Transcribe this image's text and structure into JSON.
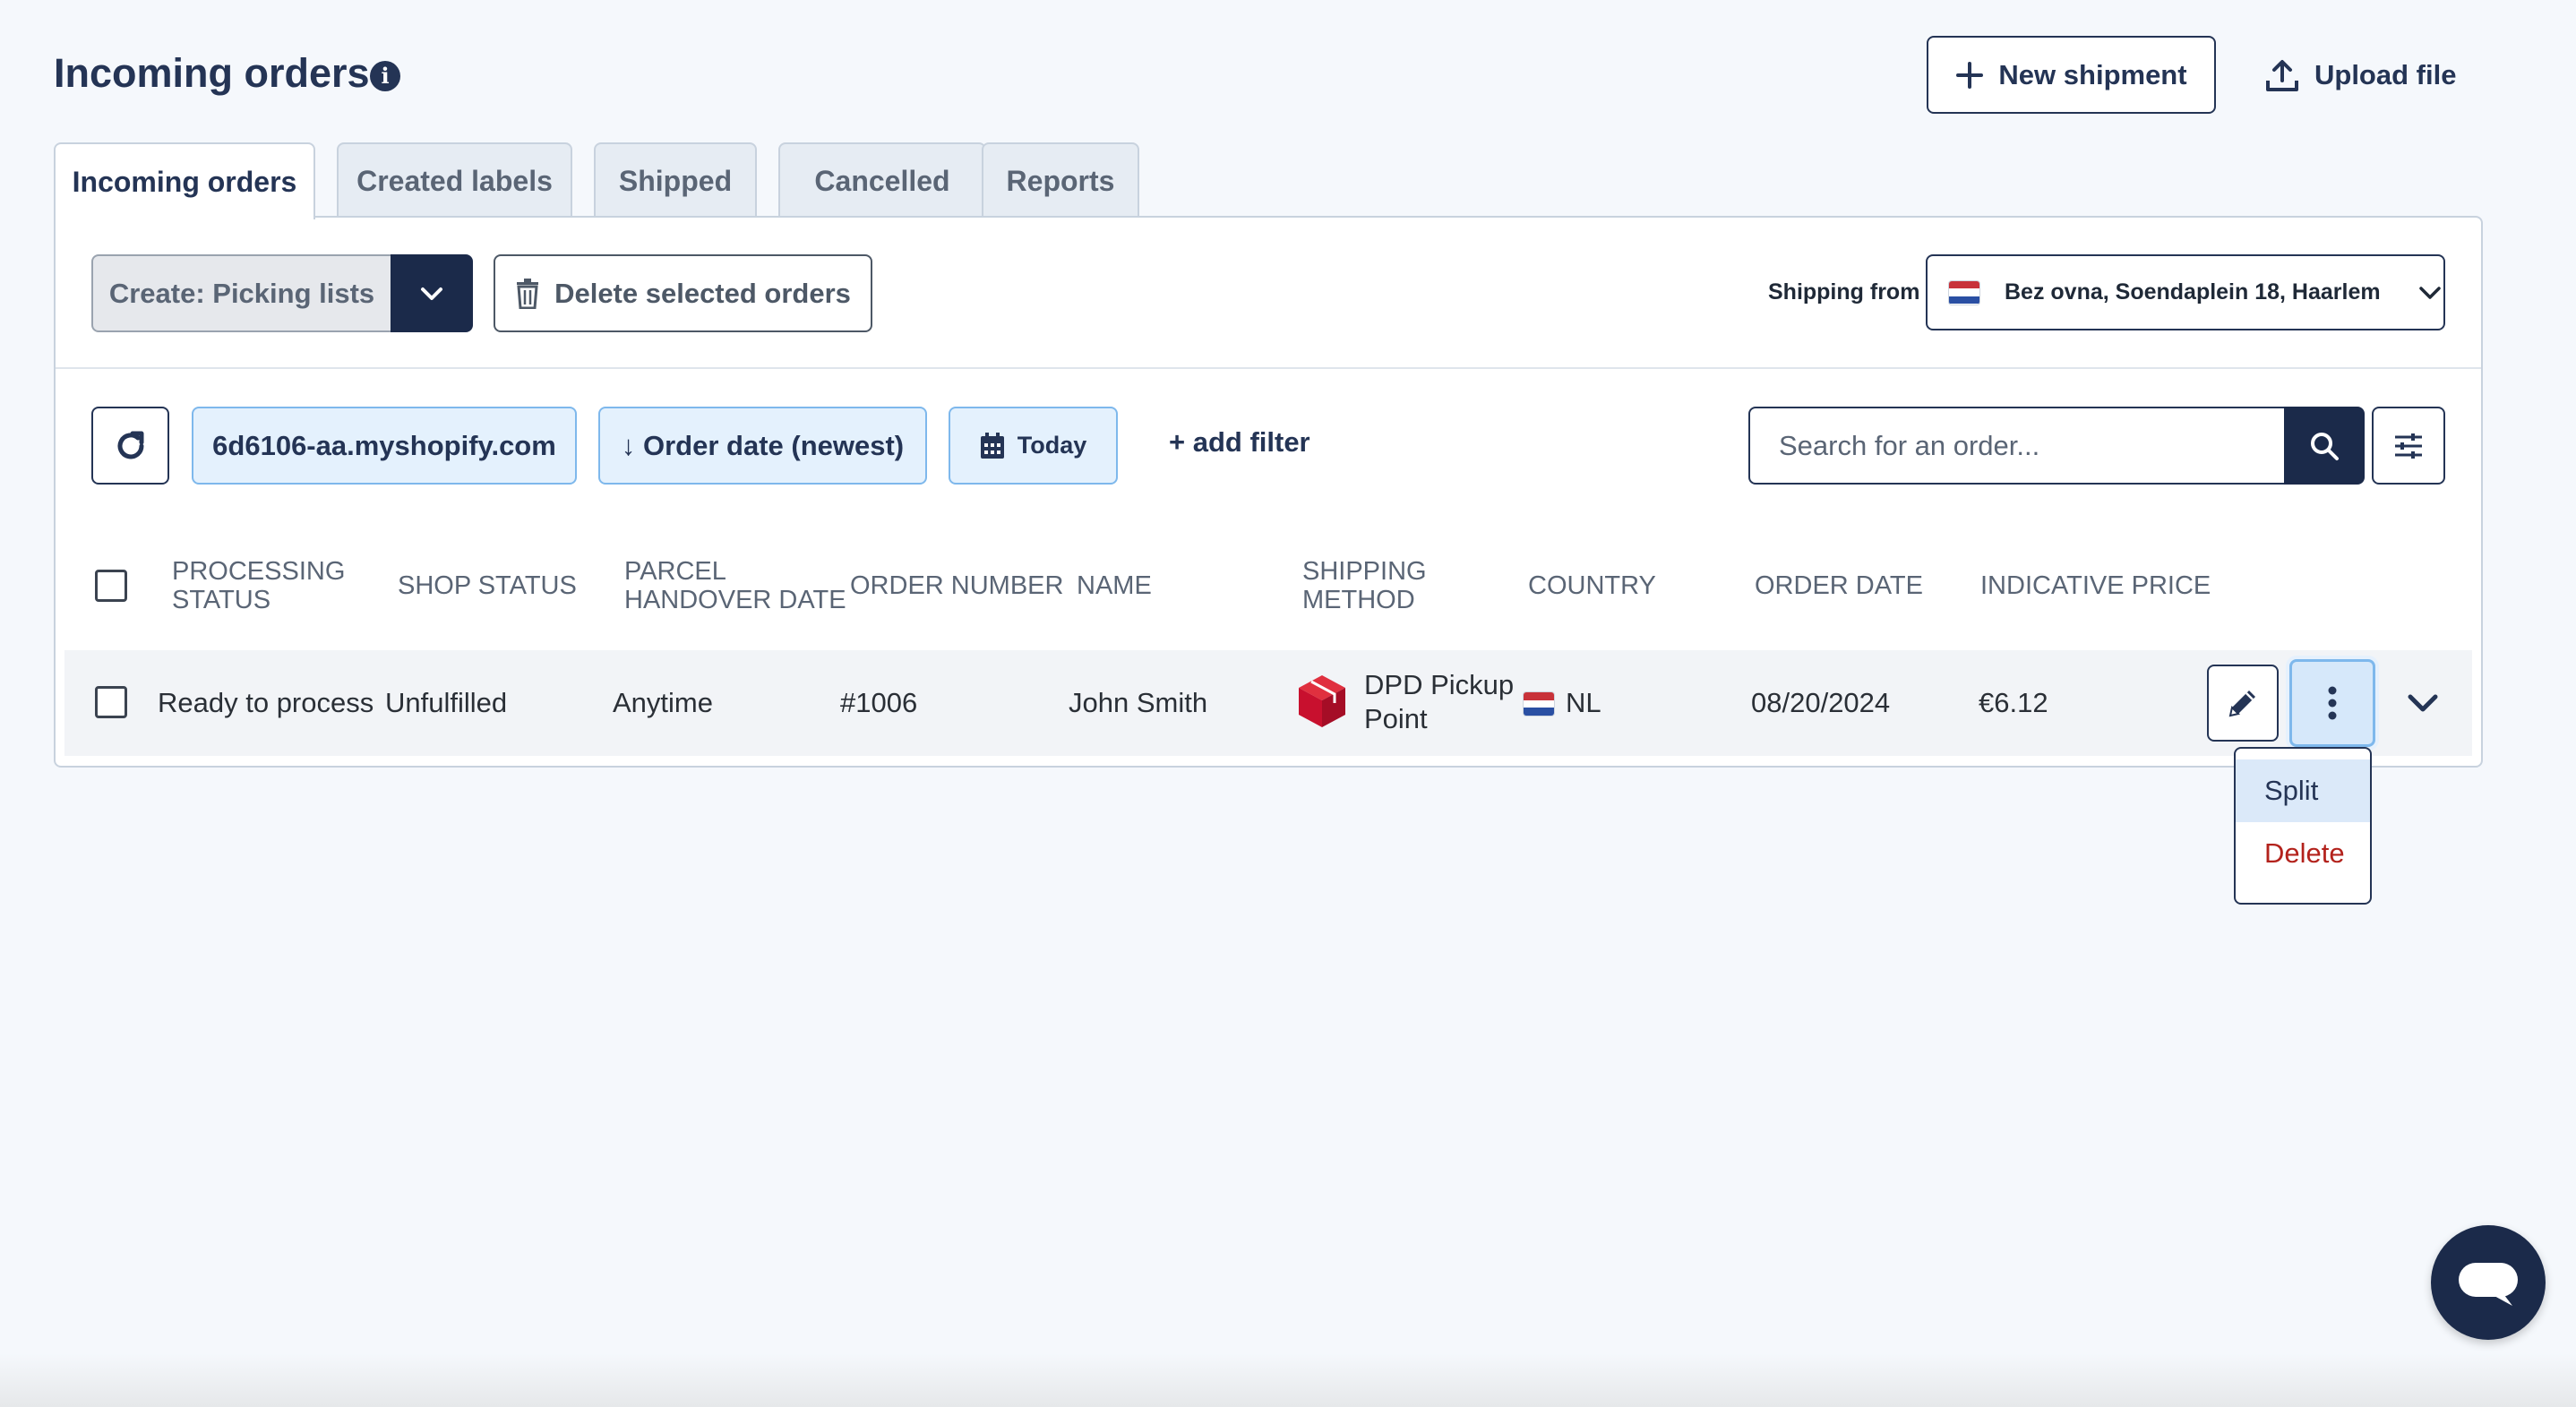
{
  "header": {
    "title": "Incoming orders",
    "new_shipment_label": "New shipment",
    "upload_file_label": "Upload file"
  },
  "tabs": [
    {
      "label": "Incoming orders",
      "active": true
    },
    {
      "label": "Created labels",
      "active": false
    },
    {
      "label": "Shipped",
      "active": false
    },
    {
      "label": "Cancelled",
      "active": false
    },
    {
      "label": "Reports",
      "active": false
    }
  ],
  "toolbar": {
    "create_label": "Create: Picking lists",
    "delete_selected_label": "Delete selected orders",
    "shipping_from_label": "Shipping from",
    "shipping_from_value": "Bez ovna, Soendaplein 18, Haarlem"
  },
  "filters": {
    "shop": "6d6106-aa.myshopify.com",
    "sort": "↓ Order date (newest)",
    "date": "Today",
    "add_filter": "+ add filter",
    "search_placeholder": "Search for an order..."
  },
  "table": {
    "headers": {
      "processing_status": "PROCESSING STATUS",
      "shop_status": "SHOP STATUS",
      "parcel_handover_date": "PARCEL HANDOVER DATE",
      "order_number": "ORDER NUMBER",
      "name": "NAME",
      "shipping_method": "SHIPPING METHOD",
      "country": "COUNTRY",
      "order_date": "ORDER DATE",
      "indicative_price": "INDICATIVE PRICE"
    },
    "rows": [
      {
        "processing_status": "Ready to process",
        "shop_status": "Unfulfilled",
        "parcel_handover_date": "Anytime",
        "order_number": "#1006",
        "name": "John Smith",
        "shipping_method": "DPD Pickup Point",
        "country": "NL",
        "order_date": "08/20/2024",
        "indicative_price": "€6.12"
      }
    ]
  },
  "row_menu": {
    "split_label": "Split",
    "delete_label": "Delete"
  },
  "colors": {
    "primary": "#1b2a4a",
    "chip_bg": "#e4f1fd",
    "chip_border": "#7eb8ec",
    "danger": "#b3221c",
    "dpd_red": "#c8102e"
  },
  "icons": {
    "info": "info-icon",
    "new_shipment": "plus-icon",
    "upload": "upload-icon",
    "create_caret": "chevron-down-icon",
    "delete_selected": "trash-icon",
    "shipping_from_flag": "nl-flag-icon",
    "refresh": "refresh-icon",
    "date": "calendar-icon",
    "search": "search-icon",
    "settings": "sliders-icon",
    "edit": "pencil-icon",
    "more": "vertical-dots-icon",
    "expand": "chevron-down-icon",
    "carrier": "dpd-logo-icon",
    "chat": "chat-icon"
  }
}
